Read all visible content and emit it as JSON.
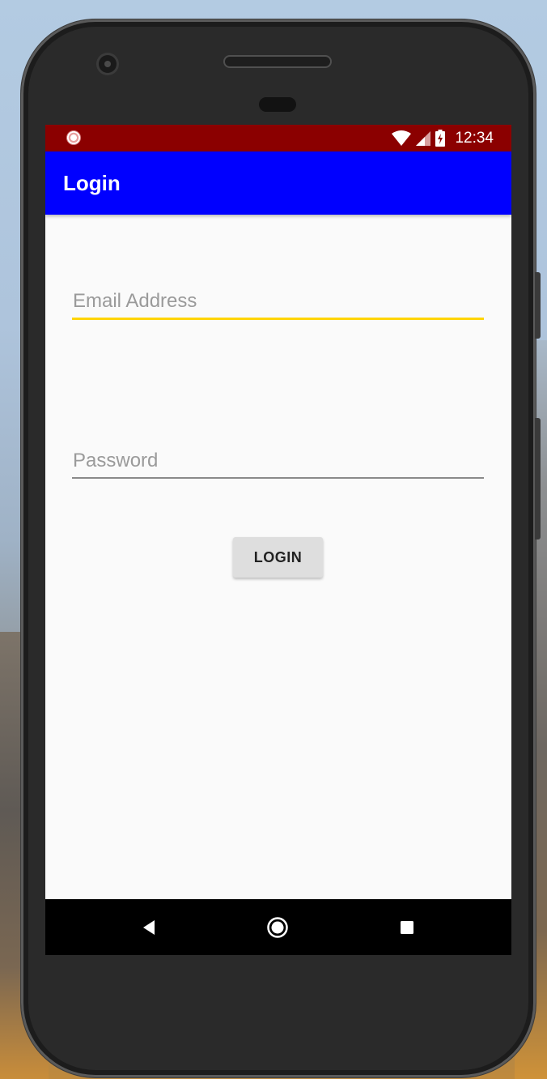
{
  "status_bar": {
    "time": "12:34",
    "left_icon": "notification-icon",
    "icons": [
      "wifi-icon",
      "cellular-signal-icon",
      "battery-charging-icon"
    ],
    "background": "#8b0000"
  },
  "app_bar": {
    "title": "Login",
    "background": "#0000ff"
  },
  "form": {
    "email": {
      "placeholder": "Email Address",
      "value": "",
      "underline_color": "#ffd400",
      "focused": true
    },
    "password": {
      "placeholder": "Password",
      "value": ""
    },
    "login_label": "LOGIN"
  },
  "nav_bar": {
    "icons": [
      "back-icon",
      "home-icon",
      "recents-icon"
    ]
  }
}
